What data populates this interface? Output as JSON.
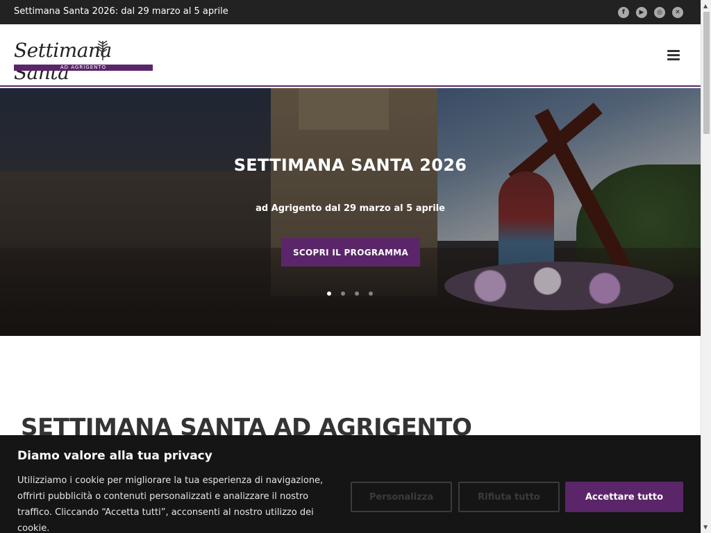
{
  "topbar": {
    "text": "Settimana Santa 2026: dal 29 marzo al 5 aprile",
    "social": [
      {
        "icon": "facebook-icon",
        "glyph": "f"
      },
      {
        "icon": "youtube-icon",
        "glyph": "▶"
      },
      {
        "icon": "instagram-icon",
        "glyph": "◎"
      },
      {
        "icon": "x-icon",
        "glyph": "✕"
      }
    ]
  },
  "header": {
    "logo_text": "Settimana Santa",
    "logo_sub": "AD AGRIGENTO",
    "menu_icon": "hamburger-menu-icon"
  },
  "hero": {
    "title": "SETTIMANA SANTA 2026",
    "subtitle": "ad Agrigento dal 29 marzo al 5 aprile",
    "button": "SCOPRI IL PROGRAMMA",
    "slides": 4,
    "active_slide": 1
  },
  "section": {
    "title": "SETTIMANA SANTA AD AGRIGENTO"
  },
  "cookie": {
    "title": "Diamo valore alla tua privacy",
    "text": "Utilizziamo i cookie per migliorare la tua esperienza di navigazione, offrirti pubblicità o contenuti personalizzati e analizzare il nostro traffico. Cliccando “Accetta tutti”, acconsenti al nostro utilizzo dei cookie.",
    "customize": "Personalizza",
    "reject": "Rifiuta tutto",
    "accept": "Accettare tutto"
  },
  "colors": {
    "brand": "#5b2669",
    "topbar": "#222222",
    "cookie_bg": "#151515"
  }
}
